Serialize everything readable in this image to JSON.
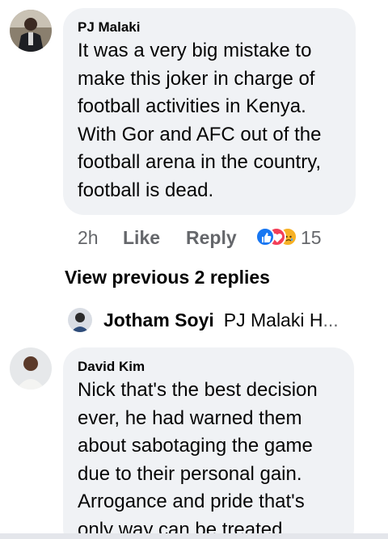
{
  "comments": [
    {
      "author": "PJ Malaki",
      "text": "It was a very big mistake to\nmake this joker in charge of\nfootball activities in Kenya.\nWith Gor and AFC out of the\nfootball arena in the country,\nfootball is dead.",
      "time": "2h",
      "like_label": "Like",
      "reply_label": "Reply",
      "reaction_count": "15",
      "reactions": [
        "like-icon",
        "love-icon",
        "sad-icon"
      ]
    },
    {
      "author": "David Kim",
      "text": "Nick that's the best decision\never, he had warned them\nabout sabotaging the game\ndue to their personal gain.\nArrogance and pride that's\nonly way can be treated"
    }
  ],
  "view_previous": "View previous 2 replies",
  "reply_preview": {
    "author": "Jotham Soyi",
    "text": "PJ Malaki H",
    "ellipsis": "..."
  },
  "colors": {
    "bubble": "#f0f2f5",
    "meta_text": "#65676b",
    "like_blue": "#1877f2",
    "love_red": "#f33e58",
    "sad_yellow": "#f7b125"
  }
}
